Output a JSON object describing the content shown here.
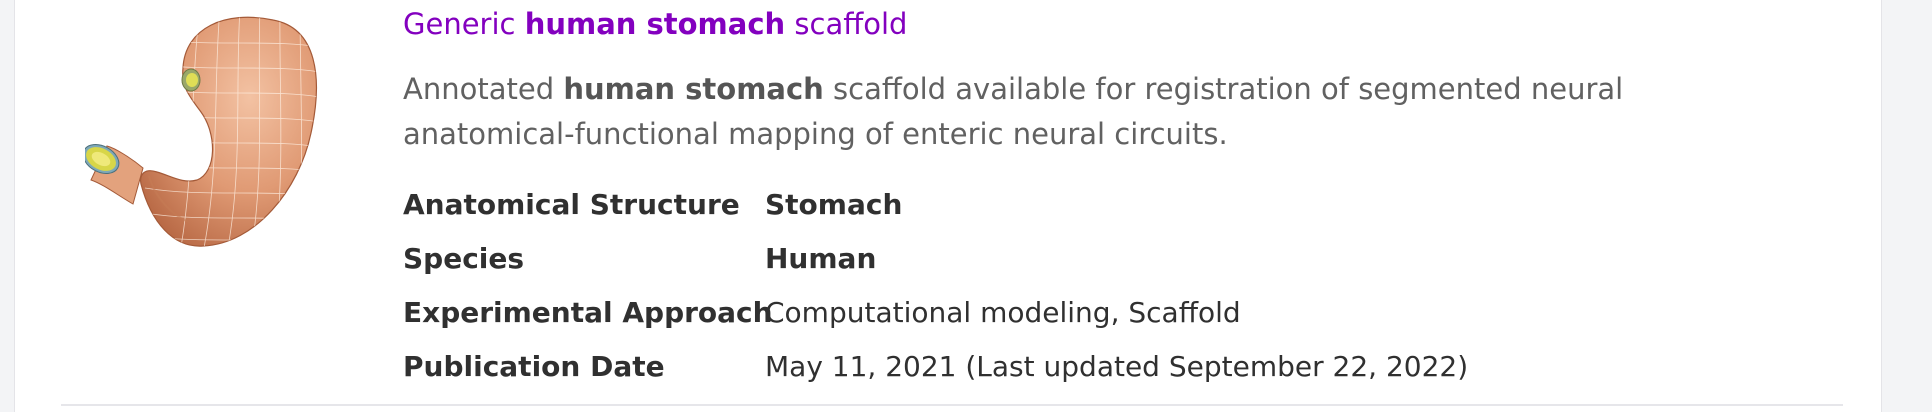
{
  "result": {
    "title_prefix": "Generic ",
    "title_bold": "human stomach",
    "title_suffix": " scaffold",
    "desc_prefix": "Annotated ",
    "desc_bold": "human stomach",
    "desc_suffix": " scaffold available for registration of segmented neural anatomical-functional mapping of enteric neural circuits.",
    "thumbnail_icon": "stomach-3d-scaffold-thumbnail",
    "fields": [
      {
        "label": "Anatomical Structure",
        "value": "Stomach"
      },
      {
        "label": "Species",
        "value": "Human"
      },
      {
        "label": "Experimental Approach",
        "value": "Computational modeling, Scaffold"
      },
      {
        "label": "Publication Date",
        "value": "May 11, 2021 (Last updated September 22, 2022)"
      }
    ]
  },
  "colors": {
    "title_link": "#8300bf",
    "stomach_fill": "#e2a07a",
    "duct_yellow": "#d8d648"
  }
}
